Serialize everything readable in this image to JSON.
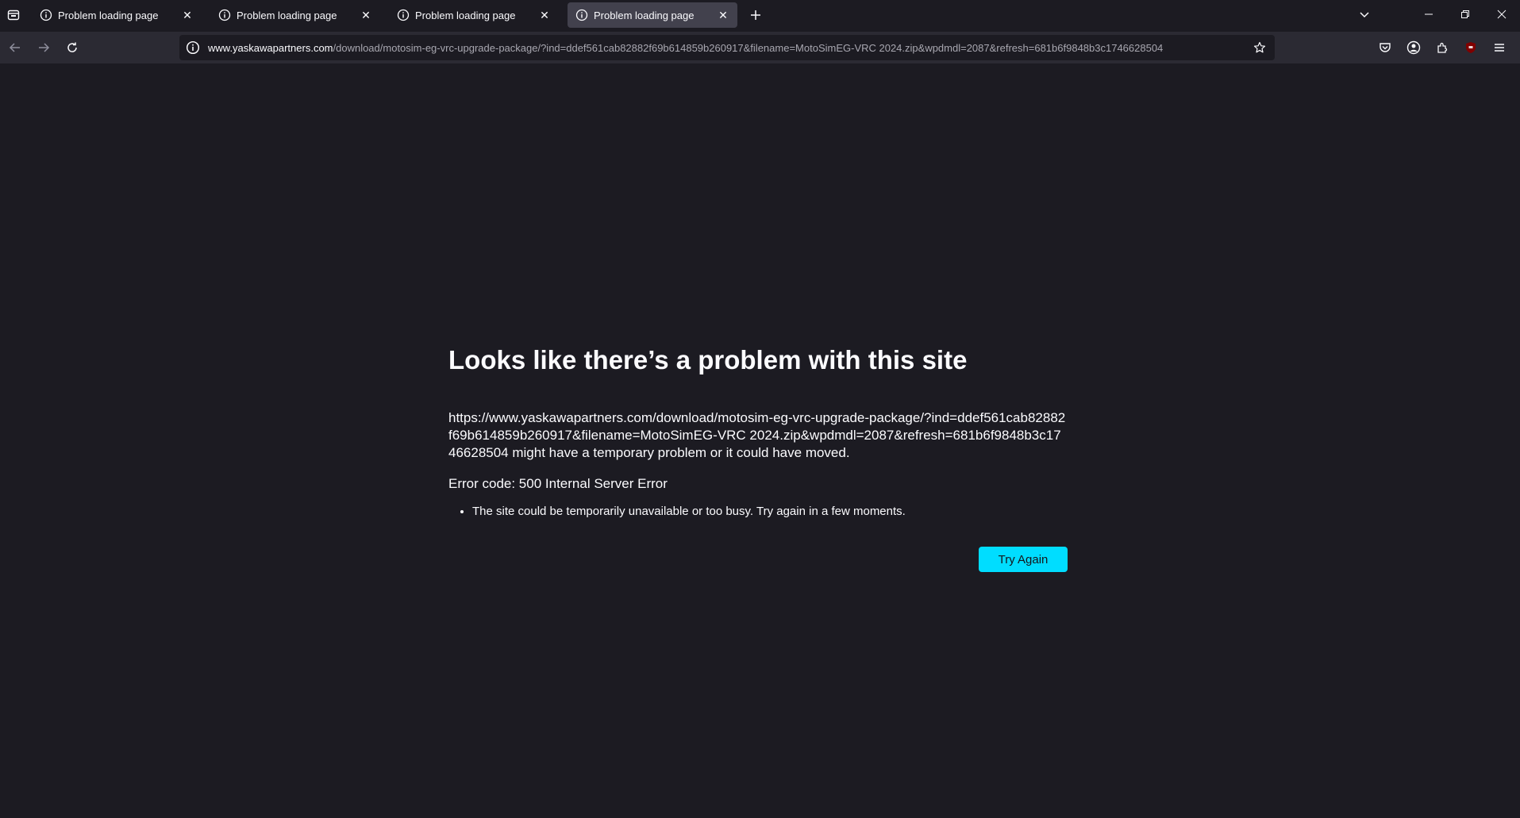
{
  "tabs": [
    {
      "title": "Problem loading page",
      "active": false
    },
    {
      "title": "Problem loading page",
      "active": false
    },
    {
      "title": "Problem loading page",
      "active": false
    },
    {
      "title": "Problem loading page",
      "active": true
    }
  ],
  "urlbar": {
    "host": "www.yaskawapartners.com",
    "path": "/download/motosim-eg-vrc-upgrade-package/?ind=ddef561cab82882f69b614859b260917&filename=MotoSimEG-VRC 2024.zip&wpdmdl=2087&refresh=681b6f9848b3c1746628504"
  },
  "error_page": {
    "title": "Looks like there’s a problem with this site",
    "description": "https://www.yaskawapartners.com/download/motosim-eg-vrc-upgrade-package/?ind=ddef561cab82882f69b614859b260917&filename=MotoSimEG-VRC 2024.zip&wpdmdl=2087&refresh=681b6f9848b3c1746628504 might have a temporary problem or it could have moved.",
    "error_code": "Error code: 500 Internal Server Error",
    "bullets": [
      "The site could be temporarily unavailable or too busy. Try again in a few moments."
    ],
    "try_again_label": "Try Again"
  },
  "colors": {
    "background": "#1c1b22",
    "toolbar": "#2b2a33",
    "accent_button": "#00ddff",
    "ublock_badge": "#800000"
  }
}
